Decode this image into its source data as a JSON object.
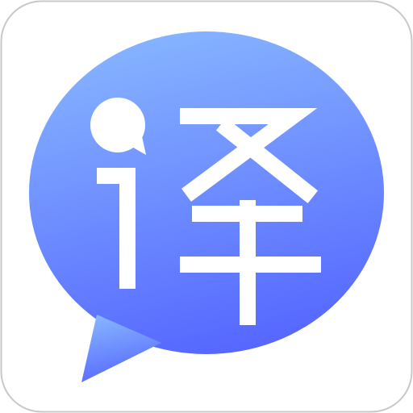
{
  "app_icon": {
    "glyph": "译",
    "tile_background": "#ffffff",
    "tile_border": "#c8c8c8",
    "bubble_gradient_top": "#86b4ff",
    "bubble_gradient_bottom": "#5566ff",
    "glyph_color": "#ffffff"
  }
}
